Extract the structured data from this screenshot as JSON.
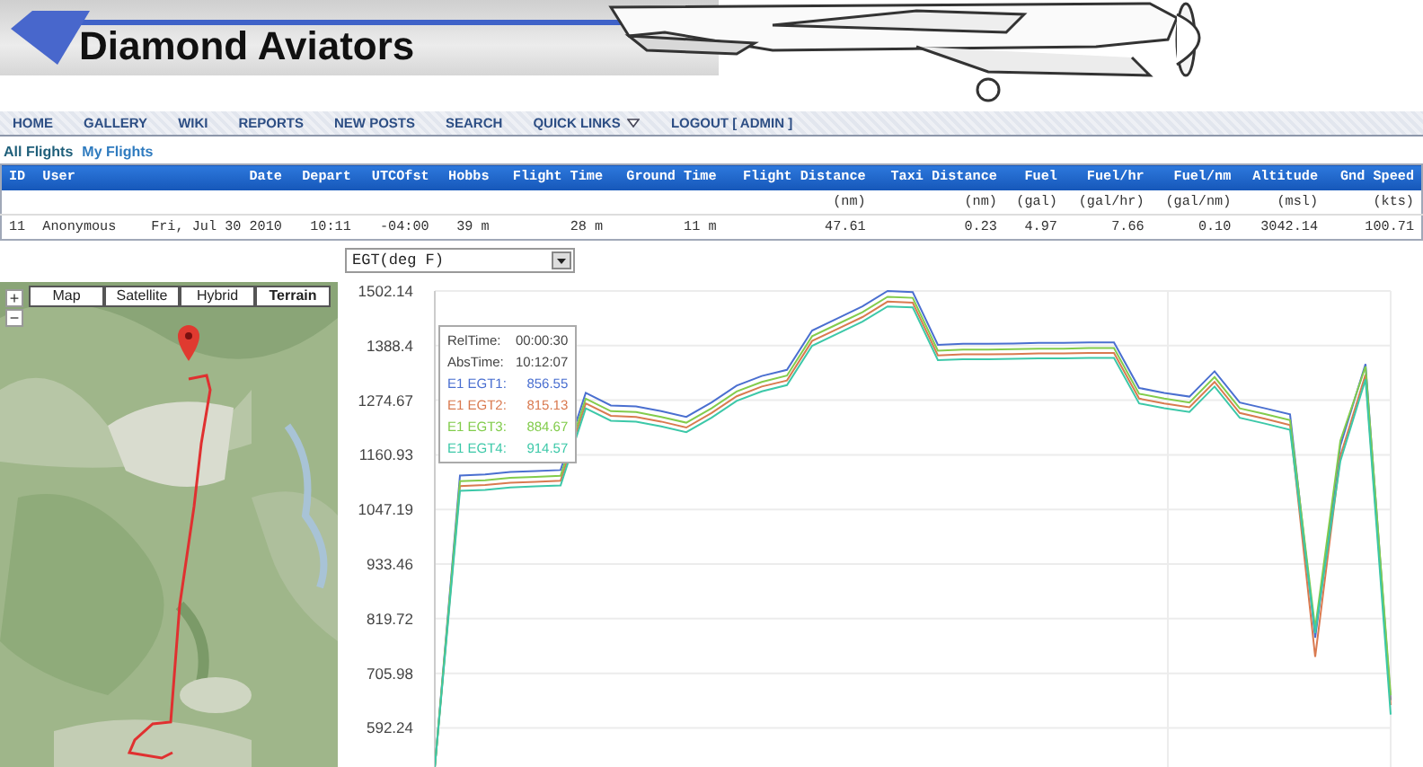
{
  "banner": {
    "title": "Diamond Aviators"
  },
  "nav": [
    {
      "label": "HOME",
      "kind": "link"
    },
    {
      "label": "GALLERY",
      "kind": "link"
    },
    {
      "label": "WIKI",
      "kind": "link"
    },
    {
      "label": "REPORTS",
      "kind": "link"
    },
    {
      "label": "NEW POSTS",
      "kind": "link"
    },
    {
      "label": "SEARCH",
      "kind": "link"
    },
    {
      "label": "QUICK LINKS",
      "kind": "menu"
    },
    {
      "label": "LOGOUT [ ADMIN ]",
      "kind": "link"
    }
  ],
  "subnav": [
    {
      "label": "All Flights",
      "selected": true
    },
    {
      "label": "My Flights",
      "selected": false
    }
  ],
  "flights_table": {
    "columns": [
      {
        "header": "ID"
      },
      {
        "header": "User"
      },
      {
        "header": "Date"
      },
      {
        "header": "Depart"
      },
      {
        "header": "UTCOfst"
      },
      {
        "header": "Hobbs"
      },
      {
        "header": "Flight Time"
      },
      {
        "header": "Ground Time"
      },
      {
        "header": "Flight Distance",
        "unit": "(nm)"
      },
      {
        "header": "Taxi Distance",
        "unit": "(nm)"
      },
      {
        "header": "Fuel",
        "unit": "(gal)"
      },
      {
        "header": "Fuel/hr",
        "unit": "(gal/hr)"
      },
      {
        "header": "Fuel/nm",
        "unit": "(gal/nm)"
      },
      {
        "header": "Altitude",
        "unit": "(msl)"
      },
      {
        "header": "Gnd Speed",
        "unit": "(kts)"
      }
    ],
    "rows": [
      {
        "cells": [
          "11",
          "Anonymous",
          "Fri, Jul 30 2010",
          "10:11",
          "-04:00",
          "39 m",
          "28 m",
          "11 m",
          "47.61",
          "0.23",
          "4.97",
          "7.66",
          "0.10",
          "3042.14",
          "100.71"
        ]
      }
    ]
  },
  "map": {
    "kind": "picture",
    "zoom_buttons": [
      "+",
      "−"
    ],
    "type_buttons": [
      {
        "label": "Map",
        "selected": false
      },
      {
        "label": "Satellite",
        "selected": false
      },
      {
        "label": "Hybrid",
        "selected": false
      },
      {
        "label": "Terrain",
        "selected": true
      }
    ]
  },
  "chart": {
    "selector": {
      "value": "EGT(deg F)"
    },
    "chart_data": {
      "type": "line",
      "categories": [
        null,
        null,
        null,
        null,
        null,
        null,
        null,
        null,
        null,
        null,
        null,
        null,
        null,
        null,
        null,
        null,
        null,
        null,
        null,
        null,
        null,
        null,
        null,
        null,
        null,
        null,
        null,
        null,
        null,
        null,
        null,
        null,
        null,
        null,
        null,
        null,
        null,
        null,
        null
      ],
      "ylim": [
        510,
        1502.14
      ],
      "grid": true,
      "yticks": [
        {
          "value": 592.24,
          "label": "592.24"
        },
        {
          "value": 705.98,
          "label": "705.98"
        },
        {
          "value": 819.72,
          "label": "819.72"
        },
        {
          "value": 933.46,
          "label": "933.46"
        },
        {
          "value": 1047.19,
          "label": "1047.19"
        },
        {
          "value": 1160.93,
          "label": "1160.93"
        },
        {
          "value": 1274.67,
          "label": "1274.67"
        },
        {
          "value": 1388.4,
          "label": "1388.4"
        },
        {
          "value": 1502.14,
          "label": "1502.14"
        }
      ],
      "series": [
        {
          "name": "E1 EGT1:",
          "color": "#4a6fd0",
          "values": [
            510,
            1118,
            1120,
            1125,
            1127,
            1129,
            1290,
            1264,
            1262,
            1252,
            1240,
            1270,
            1305,
            1325,
            1338,
            1420,
            1445,
            1470,
            1502,
            1500,
            1390,
            1392,
            1392,
            1393,
            1394,
            1394,
            1395,
            1395,
            1300,
            1290,
            1282,
            1335,
            1270,
            1258,
            1245,
            780,
            1180,
            1350,
            650
          ]
        },
        {
          "name": "E1 EGT2:",
          "color": "#d97a50",
          "values": [
            510,
            1096,
            1098,
            1103,
            1105,
            1107,
            1268,
            1242,
            1240,
            1230,
            1218,
            1248,
            1283,
            1303,
            1316,
            1398,
            1423,
            1448,
            1480,
            1478,
            1368,
            1370,
            1370,
            1371,
            1372,
            1372,
            1373,
            1373,
            1278,
            1268,
            1260,
            1313,
            1248,
            1236,
            1223,
            740,
            1158,
            1328,
            640
          ]
        },
        {
          "name": "E1 EGT3:",
          "color": "#82cc4c",
          "values": [
            510,
            1106,
            1108,
            1113,
            1115,
            1117,
            1278,
            1252,
            1250,
            1240,
            1228,
            1258,
            1293,
            1313,
            1326,
            1408,
            1433,
            1458,
            1490,
            1488,
            1378,
            1380,
            1380,
            1381,
            1382,
            1382,
            1383,
            1383,
            1288,
            1278,
            1270,
            1323,
            1258,
            1246,
            1233,
            800,
            1190,
            1345,
            660
          ]
        },
        {
          "name": "E1 EGT4:",
          "color": "#3cc8a8",
          "values": [
            510,
            1086,
            1088,
            1093,
            1095,
            1097,
            1258,
            1232,
            1230,
            1220,
            1208,
            1238,
            1273,
            1293,
            1306,
            1388,
            1413,
            1438,
            1470,
            1468,
            1358,
            1360,
            1360,
            1361,
            1362,
            1362,
            1363,
            1363,
            1268,
            1258,
            1250,
            1303,
            1238,
            1226,
            1213,
            790,
            1148,
            1318,
            620
          ]
        }
      ]
    },
    "tooltip": {
      "rows": [
        {
          "kind": "time",
          "label": "RelTime:",
          "value": "00:00:30"
        },
        {
          "kind": "time",
          "label": "AbsTime:",
          "value": "10:12:07"
        },
        {
          "kind": "series",
          "value": "856.55"
        },
        {
          "kind": "series",
          "value": "815.13"
        },
        {
          "kind": "series",
          "value": "884.67"
        },
        {
          "kind": "series",
          "value": "914.57"
        }
      ]
    }
  }
}
